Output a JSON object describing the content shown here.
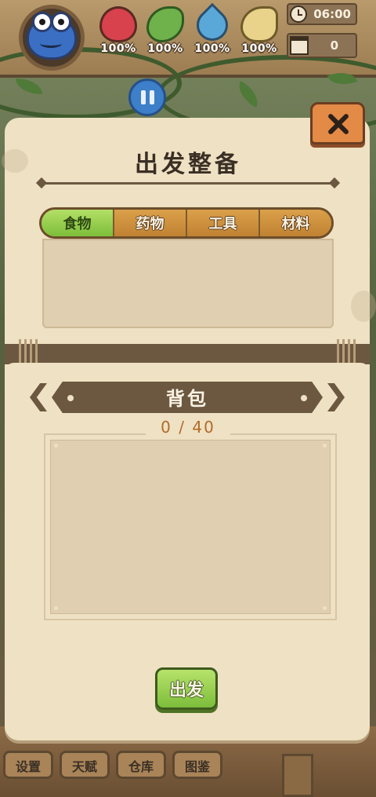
{
  "hud": {
    "stats": [
      {
        "name": "health",
        "value": "100%",
        "color": "#d8424d"
      },
      {
        "name": "hunger",
        "value": "100%",
        "color": "#6fb14a"
      },
      {
        "name": "thirst",
        "value": "100%",
        "color": "#5aa8d8"
      },
      {
        "name": "stamina",
        "value": "100%",
        "color": "#e9d38a"
      }
    ],
    "time": "06:00",
    "day": "0"
  },
  "panel": {
    "title": "出发整备",
    "tabs": [
      {
        "label": "食物",
        "active": true
      },
      {
        "label": "药物",
        "active": false
      },
      {
        "label": "工具",
        "active": false
      },
      {
        "label": "材料",
        "active": false
      }
    ],
    "backpack": {
      "title": "背包",
      "count": "0 / 40"
    },
    "depart_label": "出发"
  },
  "bottom_nav": [
    {
      "label": "设置"
    },
    {
      "label": "天赋"
    },
    {
      "label": "仓库"
    },
    {
      "label": "图鉴"
    }
  ]
}
